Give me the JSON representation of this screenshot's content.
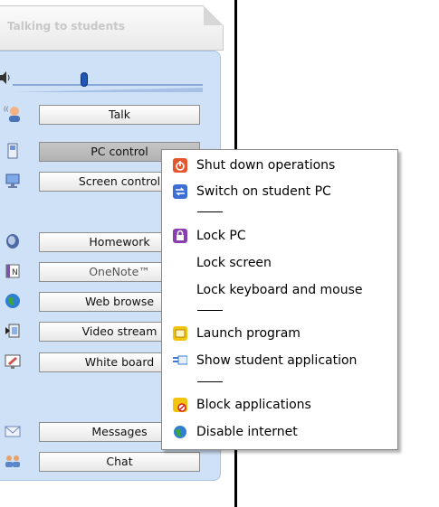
{
  "panel": {
    "title": "Talking to students",
    "buttons": [
      {
        "label": "Talk"
      },
      {
        "label": "PC control"
      },
      {
        "label": "Screen control"
      },
      {
        "label": "Homework"
      },
      {
        "label": "OneNote™"
      },
      {
        "label": "Web browse"
      },
      {
        "label": "Video stream"
      },
      {
        "label": "White board"
      },
      {
        "label": "Messages"
      },
      {
        "label": "Chat"
      }
    ]
  },
  "context_menu": {
    "items": [
      {
        "label": "Shut down operations",
        "icon": "power-icon"
      },
      {
        "label": "Switch on student PC",
        "icon": "switch-on-icon"
      },
      {
        "label": "Lock PC",
        "icon": "lock-icon"
      },
      {
        "label": "Lock screen",
        "icon": ""
      },
      {
        "label": "Lock keyboard and mouse",
        "icon": ""
      },
      {
        "label": "Launch program",
        "icon": "launch-program-icon"
      },
      {
        "label": "Show student application",
        "icon": "show-application-icon"
      },
      {
        "label": "Block applications",
        "icon": "block-applications-icon"
      },
      {
        "label": "Disable internet",
        "icon": "globe-icon"
      }
    ]
  },
  "colors": {
    "panel_background": "#cfe1f6",
    "panel_border": "#a9c2e2",
    "volume_knob": "#1f56b8"
  }
}
